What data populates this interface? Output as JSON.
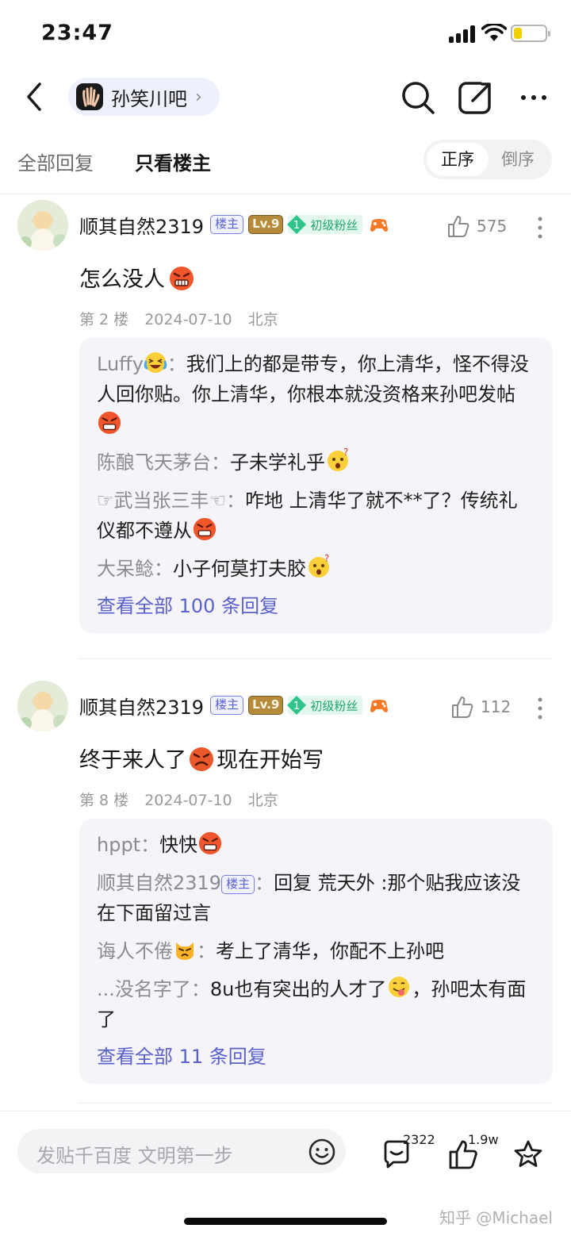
{
  "status_bar": {
    "time": "23:47",
    "battery_level": 0.25
  },
  "nav": {
    "forum_name": "孙笑川吧",
    "chevron": "›"
  },
  "filter": {
    "tab_all": "全部回复",
    "tab_owner_only": "只看楼主",
    "order_asc": "正序",
    "order_desc": "倒序",
    "active_tab": "只看楼主",
    "active_order": "正序"
  },
  "posts": [
    {
      "author": "顺其自然2319",
      "owner_badge": "楼主",
      "level": "Lv.9",
      "fan_level": "1",
      "fan_title": "初级粉丝",
      "likes": "575",
      "content": "怎么没人",
      "floor": "第 2 楼",
      "date": "2024-07-10",
      "location": "北京",
      "replies": [
        {
          "name": "Luffy",
          "sep": "：",
          "text": "我们上的都是带专，你上清华，怪不得没人回你贴。你上清华，你根本就没资格来孙吧发帖"
        },
        {
          "name": "陈酿飞天茅台",
          "sep": "：",
          "text": "子未学礼乎"
        },
        {
          "name": "☞武当张三丰☜",
          "sep": "：",
          "text": "咋地 上清华了就不**了？传统礼仪都不遵从"
        },
        {
          "name": "大呆鲶",
          "sep": "：",
          "text": "小子何莫打夫胶"
        }
      ],
      "view_all": "查看全部 100 条回复"
    },
    {
      "author": "顺其自然2319",
      "owner_badge": "楼主",
      "level": "Lv.9",
      "fan_level": "1",
      "fan_title": "初级粉丝",
      "likes": "112",
      "content_a": "终于来人了",
      "content_b": "现在开始写",
      "floor": "第 8 楼",
      "date": "2024-07-10",
      "location": "北京",
      "replies": [
        {
          "name": "hppt",
          "sep": "：",
          "text": "快快"
        },
        {
          "name": "顺其自然2319",
          "badge": "楼主",
          "sep": "：",
          "text": "回复 荒天外 :那个贴我应该没在下面留过言"
        },
        {
          "name": "诲人不倦",
          "sep": "：",
          "text": "考上了清华，你配不上孙吧"
        },
        {
          "name": "...没名字了",
          "sep": "：",
          "text_a": "8u也有突出的人才了",
          "text_b": "，孙吧太有面了"
        }
      ],
      "view_all": "查看全部 11 条回复"
    }
  ],
  "bottom_bar": {
    "compose_placeholder": "发贴千百度 文明第一步",
    "comment_count": "2322",
    "like_count": "1.9w",
    "watermark": "知乎 @Michael"
  },
  "colors": {
    "accent": "#5960cc",
    "owner_badge": "#5a60d6",
    "fan_green": "#1fa571",
    "reply_bg": "#f5f5f9"
  },
  "icons": [
    "back-icon",
    "search-icon",
    "share-icon",
    "more-icon",
    "like-icon",
    "emoji-icon",
    "comment-icon",
    "star-icon"
  ]
}
